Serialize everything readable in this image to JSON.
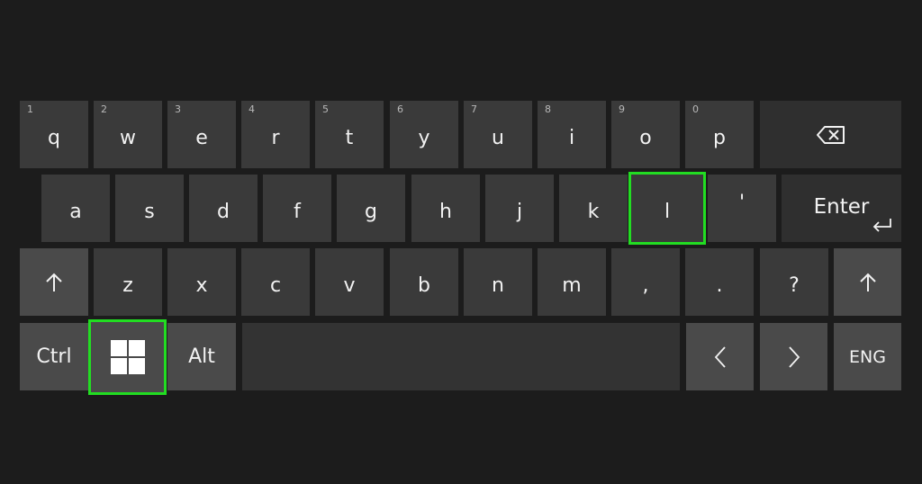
{
  "keyboard": {
    "row1": [
      "q",
      "w",
      "e",
      "r",
      "t",
      "y",
      "u",
      "i",
      "o",
      "p"
    ],
    "row1_numbers": [
      "1",
      "2",
      "3",
      "4",
      "5",
      "6",
      "7",
      "8",
      "9",
      "0"
    ],
    "row2": [
      "a",
      "s",
      "d",
      "f",
      "g",
      "h",
      "j",
      "k",
      "l",
      "'"
    ],
    "row3": [
      "z",
      "x",
      "c",
      "v",
      "b",
      "n",
      "m",
      ",",
      ".",
      "?"
    ],
    "enter_label": "Enter",
    "ctrl_label": "Ctrl",
    "alt_label": "Alt",
    "lang_label": "ENG",
    "icons": {
      "backspace": "backspace-icon",
      "shift": "shift-arrow-icon",
      "windows": "windows-logo-icon",
      "left": "chevron-left-icon",
      "right": "chevron-right-icon",
      "enter": "enter-return-icon"
    },
    "highlight_color": "#22dd22",
    "highlighted_keys": [
      "l",
      "windows"
    ]
  }
}
